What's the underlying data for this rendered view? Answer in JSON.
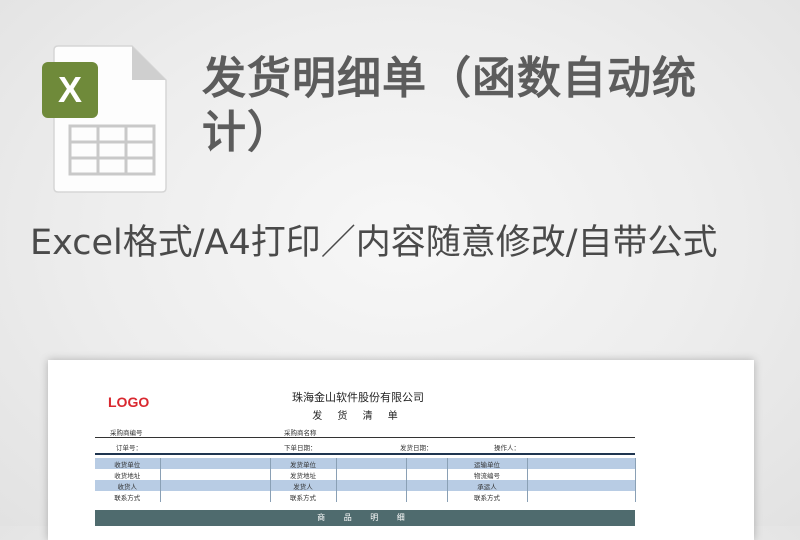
{
  "title": "发货明细单（函数自动统计）",
  "subtitle": "Excel格式/A4打印／内容随意修改/自带公式",
  "file_icon": {
    "icon": "excel-icon",
    "letter": "X",
    "accent": "#6f8a3a"
  },
  "sheet": {
    "logo": "LOGO",
    "company": "珠海金山软件股份有限公司",
    "doc_title": "发 货 清 单",
    "buyer_no_label": "采购商编号",
    "buyer_name_label": "采购商名称",
    "order_no_label": "订单号：",
    "order_date_label": "下单日期：",
    "ship_date_label": "发货日期：",
    "operator_label": "操作人：",
    "rows": [
      [
        "收货单位",
        "",
        "发货单位",
        "",
        "",
        "运输单位",
        ""
      ],
      [
        "收货地址",
        "",
        "发货地址",
        "",
        "",
        "物流编号",
        ""
      ],
      [
        "收货人",
        "",
        "发货人",
        "",
        "",
        "承运人",
        ""
      ],
      [
        "联系方式",
        "",
        "联系方式",
        "",
        "",
        "联系方式",
        ""
      ]
    ],
    "band": "商 品 明 细",
    "colors": {
      "row_blue": "#b8cce4",
      "band": "#4f6b6e",
      "logo": "#d9282f"
    }
  }
}
